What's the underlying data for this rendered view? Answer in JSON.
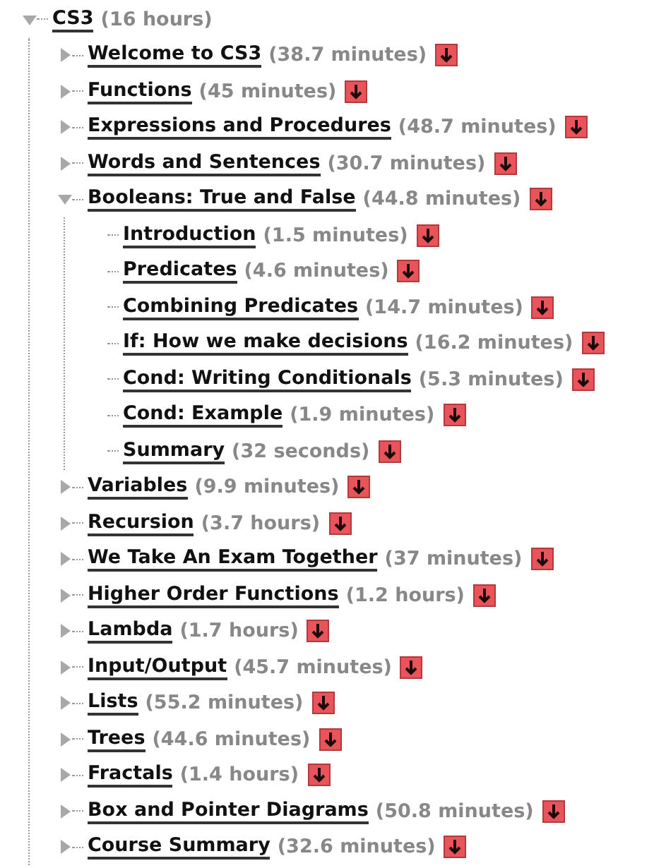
{
  "tree": {
    "title": "CS3",
    "duration": "(16 hours)",
    "expanded": true,
    "children": [
      {
        "title": "Welcome to CS3",
        "duration": "(38.7 minutes)",
        "expanded": false
      },
      {
        "title": "Functions",
        "duration": "(45 minutes)",
        "expanded": false
      },
      {
        "title": "Expressions and Procedures",
        "duration": "(48.7 minutes)",
        "expanded": false
      },
      {
        "title": "Words and Sentences",
        "duration": "(30.7 minutes)",
        "expanded": false
      },
      {
        "title": "Booleans: True and False",
        "duration": "(44.8 minutes)",
        "expanded": true,
        "children": [
          {
            "title": "Introduction",
            "duration": "(1.5 minutes)"
          },
          {
            "title": "Predicates",
            "duration": "(4.6 minutes)"
          },
          {
            "title": "Combining Predicates",
            "duration": "(14.7 minutes)"
          },
          {
            "title": "If: How we make decisions",
            "duration": "(16.2 minutes)"
          },
          {
            "title": "Cond: Writing Conditionals",
            "duration": "(5.3 minutes)"
          },
          {
            "title": "Cond: Example",
            "duration": "(1.9 minutes)"
          },
          {
            "title": "Summary",
            "duration": "(32 seconds)"
          }
        ]
      },
      {
        "title": "Variables",
        "duration": "(9.9 minutes)",
        "expanded": false
      },
      {
        "title": "Recursion",
        "duration": "(3.7 hours)",
        "expanded": false
      },
      {
        "title": "We Take An Exam Together",
        "duration": "(37 minutes)",
        "expanded": false
      },
      {
        "title": "Higher Order Functions",
        "duration": "(1.2 hours)",
        "expanded": false
      },
      {
        "title": "Lambda",
        "duration": "(1.7 hours)",
        "expanded": false
      },
      {
        "title": "Input/Output",
        "duration": "(45.7 minutes)",
        "expanded": false
      },
      {
        "title": "Lists",
        "duration": "(55.2 minutes)",
        "expanded": false
      },
      {
        "title": "Trees",
        "duration": "(44.6 minutes)",
        "expanded": false
      },
      {
        "title": "Fractals",
        "duration": "(1.4 hours)",
        "expanded": false
      },
      {
        "title": "Box and Pointer Diagrams",
        "duration": "(50.8 minutes)",
        "expanded": false
      },
      {
        "title": "Course Summary",
        "duration": "(32.6 minutes)",
        "expanded": false
      }
    ]
  }
}
